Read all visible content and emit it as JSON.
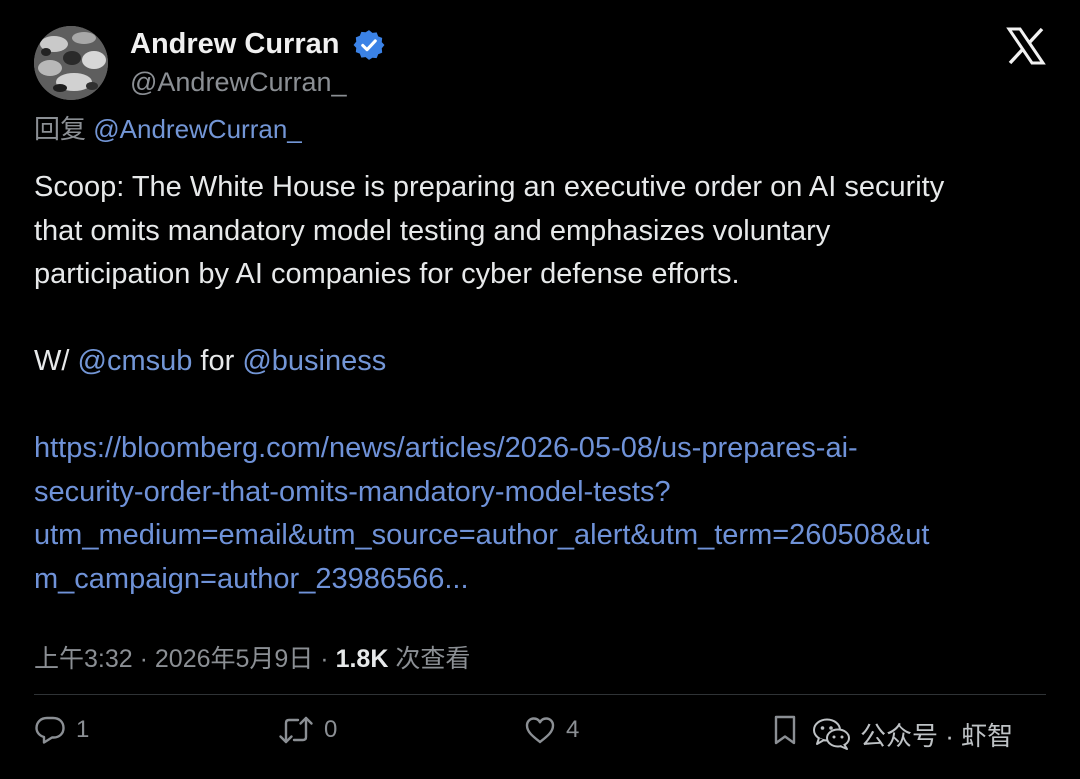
{
  "author": {
    "display_name": "Andrew Curran",
    "handle": "@AndrewCurran_",
    "verified_icon": "verified-badge-icon",
    "avatar": "avatar"
  },
  "platform_logo": "x-logo-icon",
  "reply_to": {
    "prefix": "回复",
    "handle": "@AndrewCurran_"
  },
  "tweet": {
    "lines": [
      "Scoop: The White House is preparing an executive order on AI security",
      "that omits mandatory model testing and emphasizes voluntary",
      "participation by AI companies for cyber defense efforts."
    ],
    "with_prefix": "W/ ",
    "with_mention_1": "@cmsub",
    "with_middle": " for ",
    "with_mention_2": "@business",
    "link_lines": [
      "https://bloomberg.com/news/articles/2026-05-08/us-prepares-ai-",
      "security-order-that-omits-mandatory-model-tests?",
      "utm_medium=email&utm_source=author_alert&utm_term=260508&ut",
      "m_campaign=author_23986566..."
    ]
  },
  "meta": {
    "time": "上午3:32",
    "separator": "·",
    "date": "2026年5月9日",
    "views_count": "1.8K",
    "views_label": "次查看"
  },
  "actions": {
    "replies": "1",
    "retweets": "0",
    "likes": "4"
  },
  "watermark": {
    "text": "公众号 · 虾智",
    "icon": "wechat-icon"
  },
  "colors": {
    "background": "#000000",
    "text": "#e7e9ea",
    "secondary": "#8b8f94",
    "link": "#6f92d8",
    "verified": "#3b82e6"
  }
}
